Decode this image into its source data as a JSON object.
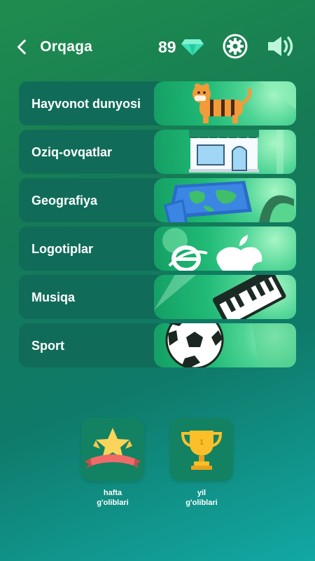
{
  "header": {
    "back_label": "Orqaga",
    "coins": "89",
    "icons": [
      "back-arrow-icon",
      "diamond-icon",
      "gear-icon",
      "speaker-icon"
    ]
  },
  "categories": [
    {
      "label": "Hayvonot dunyosi",
      "icon": "tiger-icon"
    },
    {
      "label": "Oziq-ovqatlar",
      "icon": "shop-icon"
    },
    {
      "label": "Geografiya",
      "icon": "map-icon"
    },
    {
      "label": "Logotiplar",
      "icon": "logos-icon"
    },
    {
      "label": "Musiqa",
      "icon": "piano-icon"
    },
    {
      "label": "Sport",
      "icon": "soccer-ball-icon"
    }
  ],
  "awards": [
    {
      "label_line1": "hafta",
      "label_line2": "g'oliblari",
      "icon": "star-ribbon-icon"
    },
    {
      "label_line1": "yil",
      "label_line2": "g'oliblari",
      "icon": "trophy-icon"
    }
  ],
  "colors": {
    "accent_green": "#21ba76",
    "diamond": "#3ee0b5",
    "button_bg": "#106c59"
  }
}
